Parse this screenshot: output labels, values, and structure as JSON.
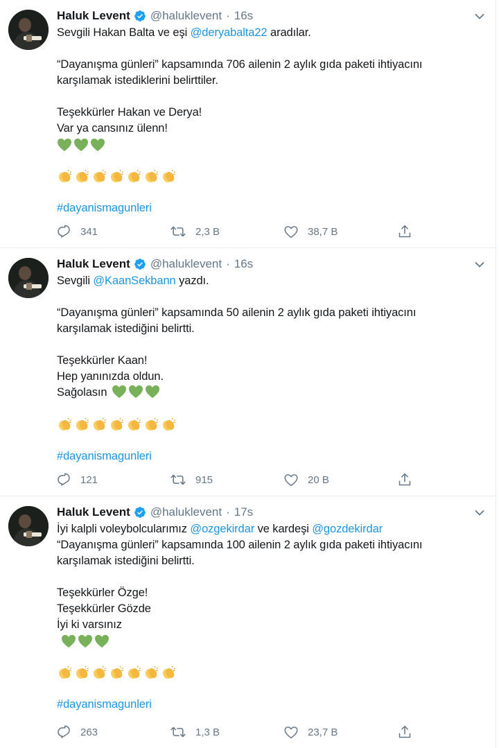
{
  "colors": {
    "link": "#1b95e0",
    "text": "#14171a",
    "muted": "#657786",
    "verified": "#1da1f2",
    "heart_emoji": "#78b159",
    "clap_emoji": "#fdcb58"
  },
  "tweets": [
    {
      "name": "Haluk Levent",
      "handle": "@haluklevent",
      "separator": "·",
      "time": "16s",
      "lines": [
        {
          "parts": [
            "Sevgili Hakan Balta ve eşi ",
            "@deryabalta22",
            "  aradılar."
          ]
        },
        {
          "gap": true
        },
        {
          "parts": [
            "“Dayanışma günleri” kapsamında 706 ailenin 2 aylık gıda paketi ihtiyacını"
          ]
        },
        {
          "parts": [
            "karşılamak istediklerini  belirttiler."
          ]
        },
        {
          "gap": true
        },
        {
          "parts": [
            "Teşekkürler Hakan ve Derya!"
          ]
        },
        {
          "parts": [
            "Var ya cansınız ülenn!"
          ]
        }
      ],
      "hashtag": "#dayanismagunleri",
      "stats": {
        "replies": "341",
        "retweets": "2,3 B",
        "likes": "38,7 B"
      },
      "icons": {
        "reply": "reply-icon",
        "retweet": "retweet-icon",
        "like": "like-icon",
        "share": "share-icon"
      }
    },
    {
      "name": "Haluk Levent",
      "handle": "@haluklevent",
      "separator": "·",
      "time": "16s",
      "lines": [
        {
          "parts": [
            "Sevgili ",
            "@KaanSekbann",
            " yazdı."
          ]
        },
        {
          "gap": true
        },
        {
          "parts": [
            "“Dayanışma günleri” kapsamında   50 ailenin 2 aylık gıda paketi ihtiyacını"
          ]
        },
        {
          "parts": [
            "karşılamak istediğini belirtti."
          ]
        },
        {
          "gap": true
        },
        {
          "parts": [
            "Teşekkürler Kaan!"
          ]
        },
        {
          "parts": [
            "Hep yanınızda oldun."
          ]
        },
        {
          "parts": [
            "Sağolasın"
          ]
        }
      ],
      "hashtag": "#dayanismagunleri",
      "stats": {
        "replies": "121",
        "retweets": "915",
        "likes": "20 B"
      },
      "icons": {
        "reply": "reply-icon",
        "retweet": "retweet-icon",
        "like": "like-icon",
        "share": "share-icon"
      }
    },
    {
      "name": "Haluk Levent",
      "handle": "@haluklevent",
      "separator": "·",
      "time": "17s",
      "lines": [
        {
          "parts": [
            "İyi kalpli voleybolcularımız ",
            "@ozgekirdar",
            " ve kardeşi ",
            "@gozdekirdar"
          ]
        },
        {
          "parts": [
            "“Dayanışma günleri” kapsamında   100 ailenin 2 aylık gıda paketi ihtiyacını"
          ]
        },
        {
          "parts": [
            "karşılamak istediğini belirtti."
          ]
        },
        {
          "gap": true
        },
        {
          "parts": [
            "Teşekkürler Özge!"
          ]
        },
        {
          "parts": [
            "Teşekkürler Gözde"
          ]
        },
        {
          "parts": [
            "İyi ki varsınız"
          ]
        }
      ],
      "hashtag": "#dayanismagunleri",
      "stats": {
        "replies": "263",
        "retweets": "1,3 B",
        "likes": "23,7 B"
      },
      "icons": {
        "reply": "reply-icon",
        "retweet": "retweet-icon",
        "like": "like-icon",
        "share": "share-icon"
      }
    }
  ]
}
